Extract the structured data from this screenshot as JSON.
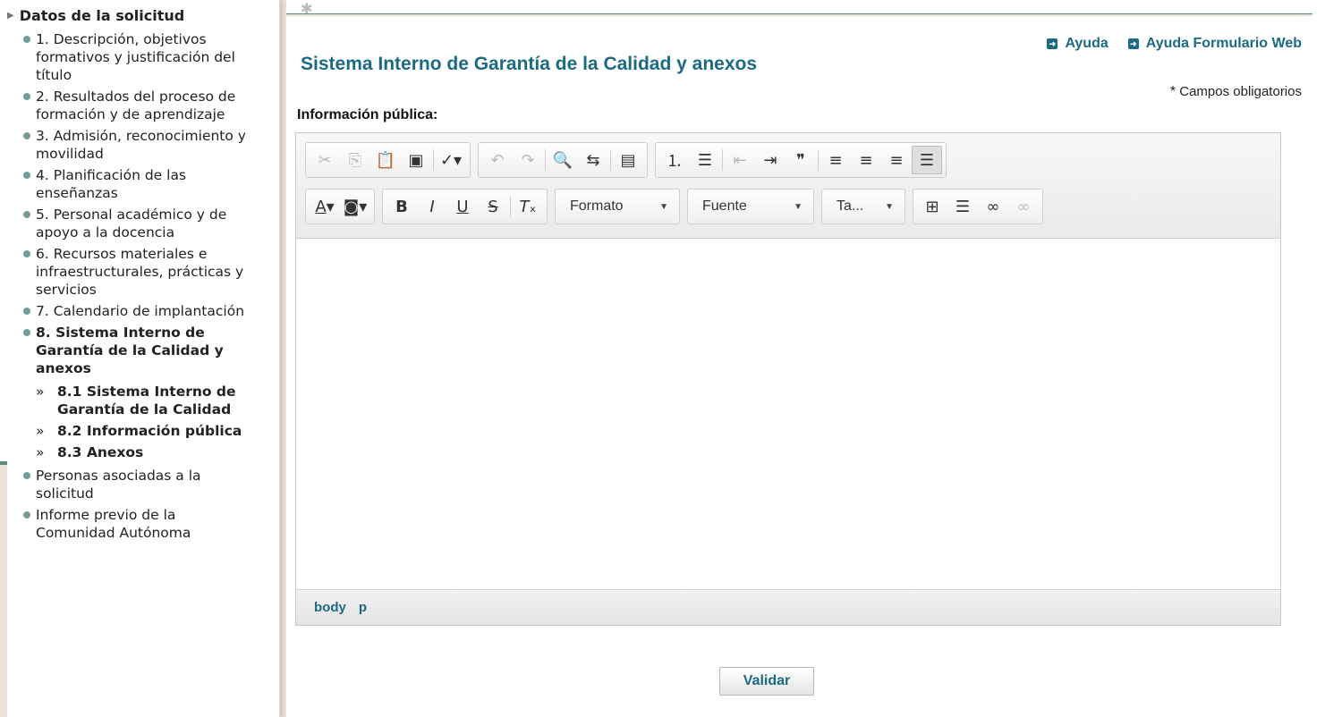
{
  "sidebar": {
    "header": "Datos de la solicitud",
    "items": [
      {
        "label": "1. Descripción, objetivos formativos y justificación del título"
      },
      {
        "label": "2. Resultados del proceso de formación y de aprendizaje"
      },
      {
        "label": "3. Admisión, reconocimiento y movilidad"
      },
      {
        "label": "4. Planificación de las enseñanzas"
      },
      {
        "label": "5. Personal académico y de apoyo a la docencia"
      },
      {
        "label": "6. Recursos materiales e infraestructurales, prácticas y servicios"
      },
      {
        "label": "7. Calendario de implantación"
      },
      {
        "label": "8. Sistema Interno de Garantía de la Calidad y anexos"
      },
      {
        "label": "Personas asociadas a la solicitud"
      },
      {
        "label": "Informe previo de la Comunidad Autónoma"
      }
    ],
    "subitems": [
      {
        "label": "8.1 Sistema Interno de Garantía de la Calidad"
      },
      {
        "label": "8.2 Información pública"
      },
      {
        "label": "8.3 Anexos"
      }
    ]
  },
  "header": {
    "help": "Ayuda",
    "help_form": "Ayuda Formulario Web"
  },
  "main": {
    "title": "Sistema Interno de Garantía de la Calidad y anexos",
    "required_note": "Campos obligatorios",
    "required_star": "*",
    "field_label": "Información pública:"
  },
  "editor": {
    "combos": {
      "format": "Formato",
      "font": "Fuente",
      "size": "Ta..."
    },
    "path": [
      "body",
      "p"
    ],
    "content": ""
  },
  "actions": {
    "validate": "Validar"
  },
  "colors": {
    "accent": "#1b6a83",
    "bullet": "#6f9e9a",
    "frame": "#5e8a84"
  }
}
